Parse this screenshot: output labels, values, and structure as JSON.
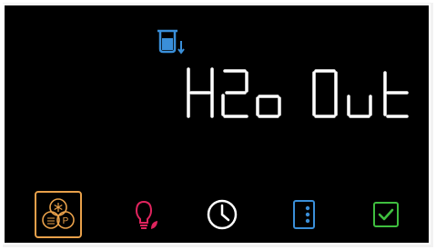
{
  "display": {
    "message": "H2o Out"
  },
  "status": {
    "icon": "water-tank-dispense-icon",
    "color": "#3a8fd9"
  },
  "toolbar": {
    "buttons": [
      {
        "id": "modes",
        "icon": "modes-icon",
        "color": "#e8a04a",
        "selected": true
      },
      {
        "id": "light",
        "icon": "eco-light-icon",
        "color": "#e0245e",
        "selected": false
      },
      {
        "id": "timer",
        "icon": "clock-icon",
        "color": "#ffffff",
        "selected": false
      },
      {
        "id": "menu",
        "icon": "more-menu-icon",
        "color": "#3a8fd9",
        "selected": false
      },
      {
        "id": "confirm",
        "icon": "check-icon",
        "color": "#3fbf3f",
        "selected": false
      }
    ]
  }
}
